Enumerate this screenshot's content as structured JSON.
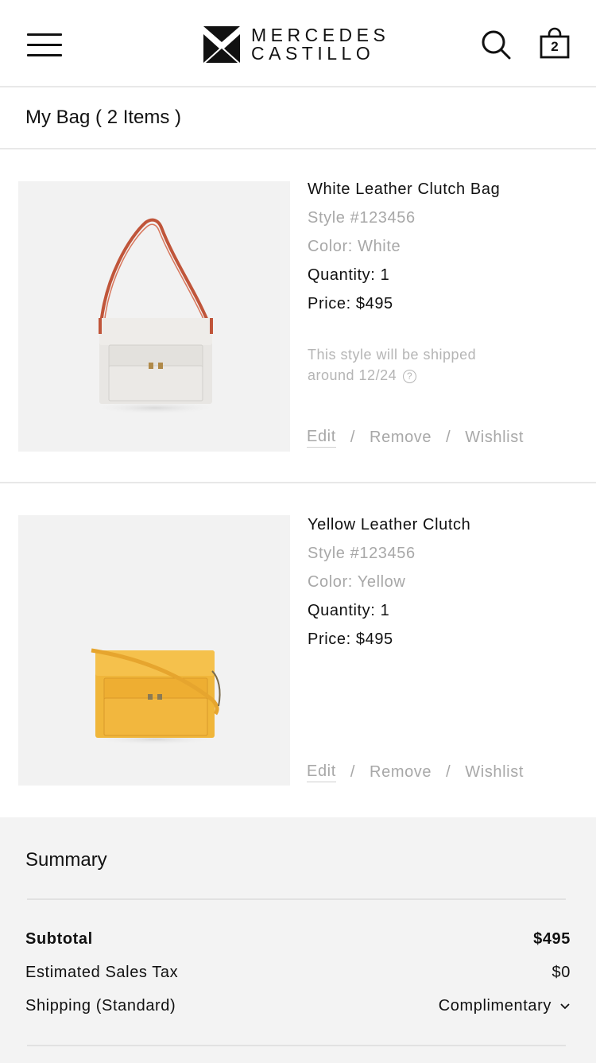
{
  "header": {
    "logo": {
      "line1": "MERCEDES",
      "line2": "CASTILLO"
    },
    "menu_icon": "hamburger-icon",
    "search_icon": "search-icon",
    "bag_icon": "shopping-bag-icon",
    "bag_count": "2"
  },
  "bag": {
    "title": "My Bag ( 2 Items )"
  },
  "items": [
    {
      "name": "White Leather Clutch Bag",
      "style": "Style #123456",
      "color": "Color: White",
      "quantity": "Quantity: 1",
      "price": "Price: $495",
      "ship_note_line1": "This style will be shipped",
      "ship_note_line2": "around 12/24",
      "help_icon": "question-circle-icon",
      "actions": {
        "edit": "Edit",
        "sep": "/",
        "remove": "Remove",
        "wishlist": "Wishlist"
      },
      "image": "white-handbag-image"
    },
    {
      "name": "Yellow Leather Clutch",
      "style": "Style #123456",
      "color": "Color: Yellow",
      "quantity": "Quantity: 1",
      "price": "Price: $495",
      "actions": {
        "edit": "Edit",
        "sep": "/",
        "remove": "Remove",
        "wishlist": "Wishlist"
      },
      "image": "yellow-handbag-image"
    }
  ],
  "summary": {
    "title": "Summary",
    "subtotal_label": "Subtotal",
    "subtotal_value": "$495",
    "tax_label": "Estimated Sales Tax",
    "tax_value": "$0",
    "shipping_label": "Shipping (Standard)",
    "shipping_value": "Complimentary",
    "shipping_icon": "chevron-down-icon"
  },
  "colors": {
    "text": "#111111",
    "muted": "#a8a8a8",
    "divider": "#e8e8e8",
    "summary_bg": "#f3f3f3",
    "image_bg": "#f2f2f2"
  }
}
